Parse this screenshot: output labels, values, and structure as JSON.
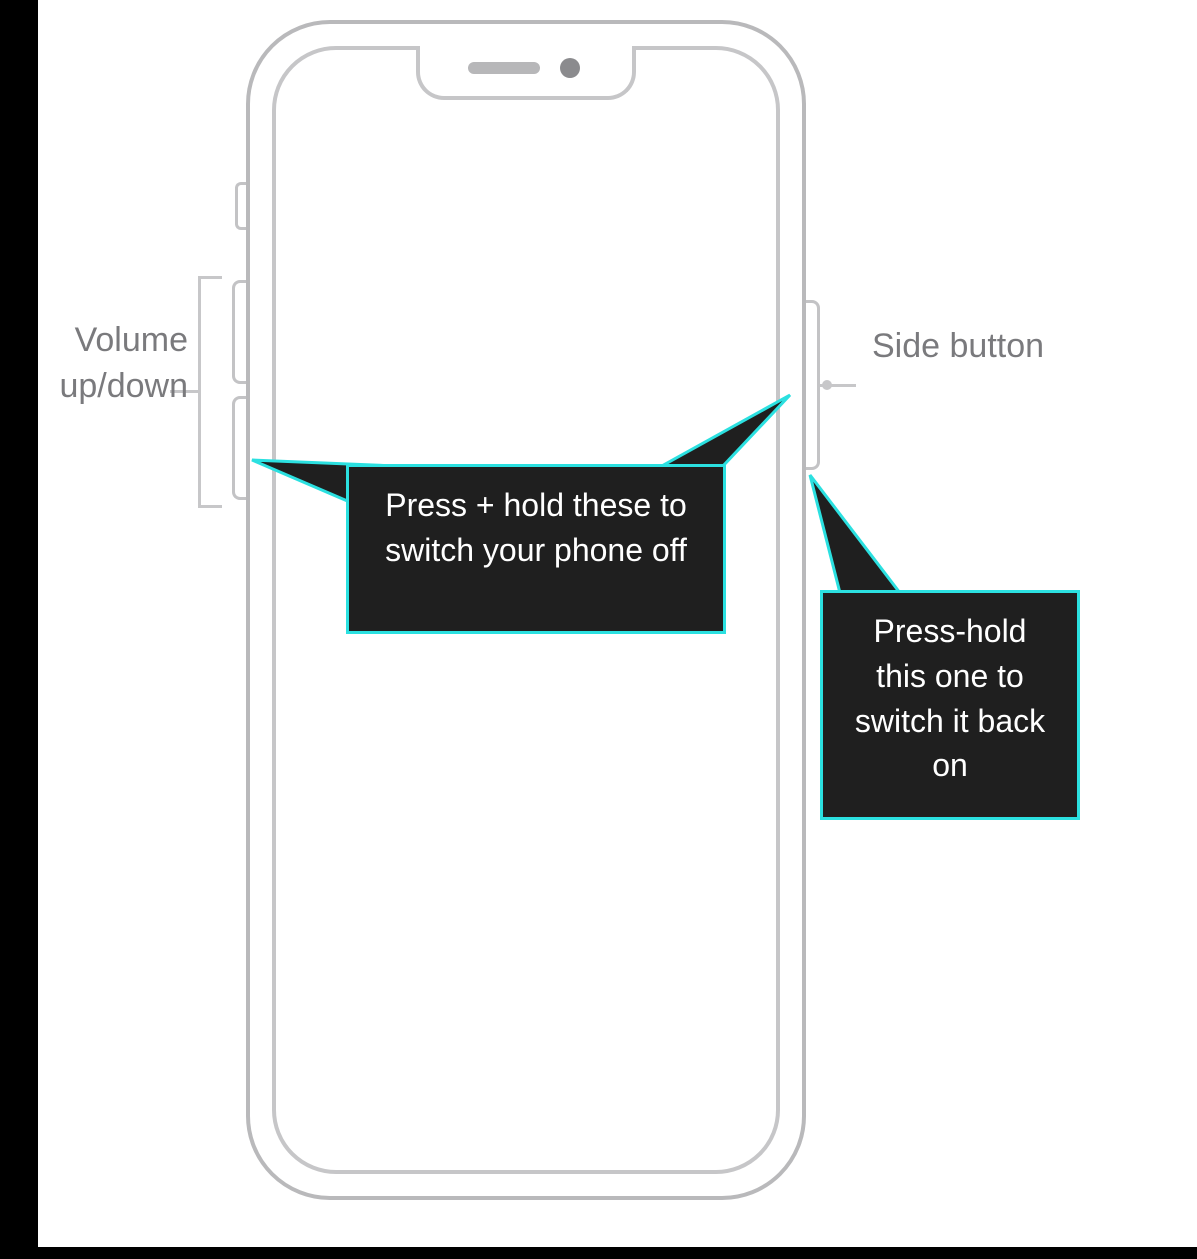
{
  "labels": {
    "volume": "Volume up/down",
    "side": "Side button"
  },
  "callouts": {
    "off": "Press + hold these to switch your phone off",
    "on": "Press-hold this one to switch it back on"
  },
  "colors": {
    "accent": "#2be0e0",
    "callout_bg": "#1f1f1f",
    "outline": "#b9b9bb",
    "label": "#7a7a7d"
  }
}
